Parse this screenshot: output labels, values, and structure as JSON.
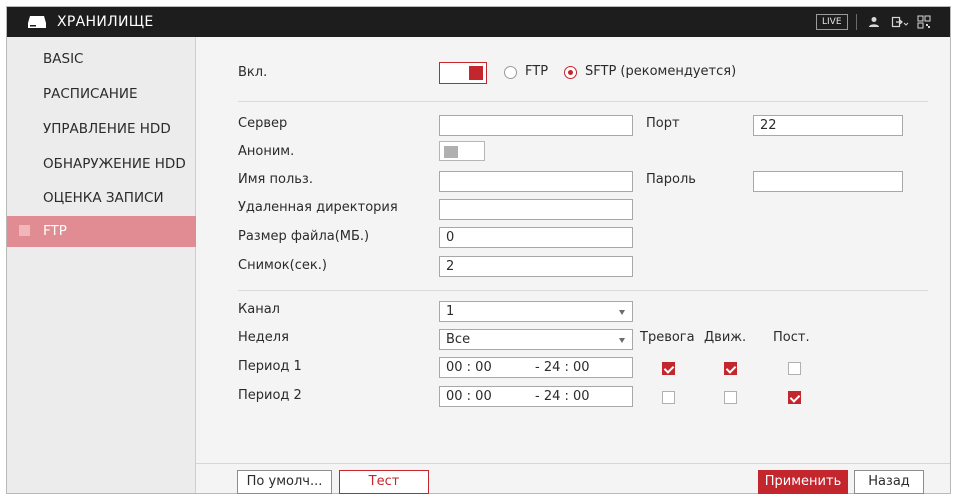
{
  "header": {
    "title": "ХРАНИЛИЩЕ",
    "live_label": "LIVE",
    "icons": [
      "storage-icon",
      "user-icon",
      "logout-icon",
      "qr-icon"
    ]
  },
  "sidebar": {
    "items": [
      {
        "label": "BASIC",
        "active": false
      },
      {
        "label": "РАСПИСАНИЕ",
        "active": false
      },
      {
        "label": "УПРАВЛЕНИЕ HDD",
        "active": false
      },
      {
        "label": "ОБНАРУЖЕНИЕ HDD",
        "active": false
      },
      {
        "label": "ОЦЕНКА ЗАПИСИ",
        "active": false
      },
      {
        "label": "FTP",
        "active": true
      }
    ]
  },
  "form": {
    "enable_label": "Вкл.",
    "enable_on": true,
    "protocol": {
      "options": [
        "FTP",
        "SFTP (рекомендуется)"
      ],
      "selected": "SFTP (рекомендуется)"
    },
    "server_label": "Сервер",
    "server_value": "",
    "port_label": "Порт",
    "port_value": "22",
    "anon_label": "Аноним.",
    "anon_on": false,
    "user_label": "Имя польз.",
    "user_value": "",
    "password_label": "Пароль",
    "password_value": "",
    "remote_dir_label": "Удаленная директория",
    "remote_dir_value": "",
    "file_size_label": "Размер файла(МБ.)",
    "file_size_value": "0",
    "snapshot_label": "Снимок(сек.)",
    "snapshot_value": "2",
    "channel_label": "Канал",
    "channel_value": "1",
    "week_label": "Неделя",
    "week_value": "Все",
    "col_headers": [
      "Тревога",
      "Движ.",
      "Пост."
    ],
    "periods": [
      {
        "label": "Период 1",
        "start": "00 : 00",
        "end": "- 24 : 00",
        "alarm": true,
        "motion": true,
        "regular": false
      },
      {
        "label": "Период 2",
        "start": "00 : 00",
        "end": "- 24 : 00",
        "alarm": false,
        "motion": false,
        "regular": true
      }
    ]
  },
  "footer": {
    "default_label": "По умолч...",
    "test_label": "Тест",
    "apply_label": "Применить",
    "back_label": "Назад"
  },
  "colors": {
    "accent": "#c4262e",
    "sidebar_active": "#e08c92",
    "topbar": "#1d1d1d"
  }
}
